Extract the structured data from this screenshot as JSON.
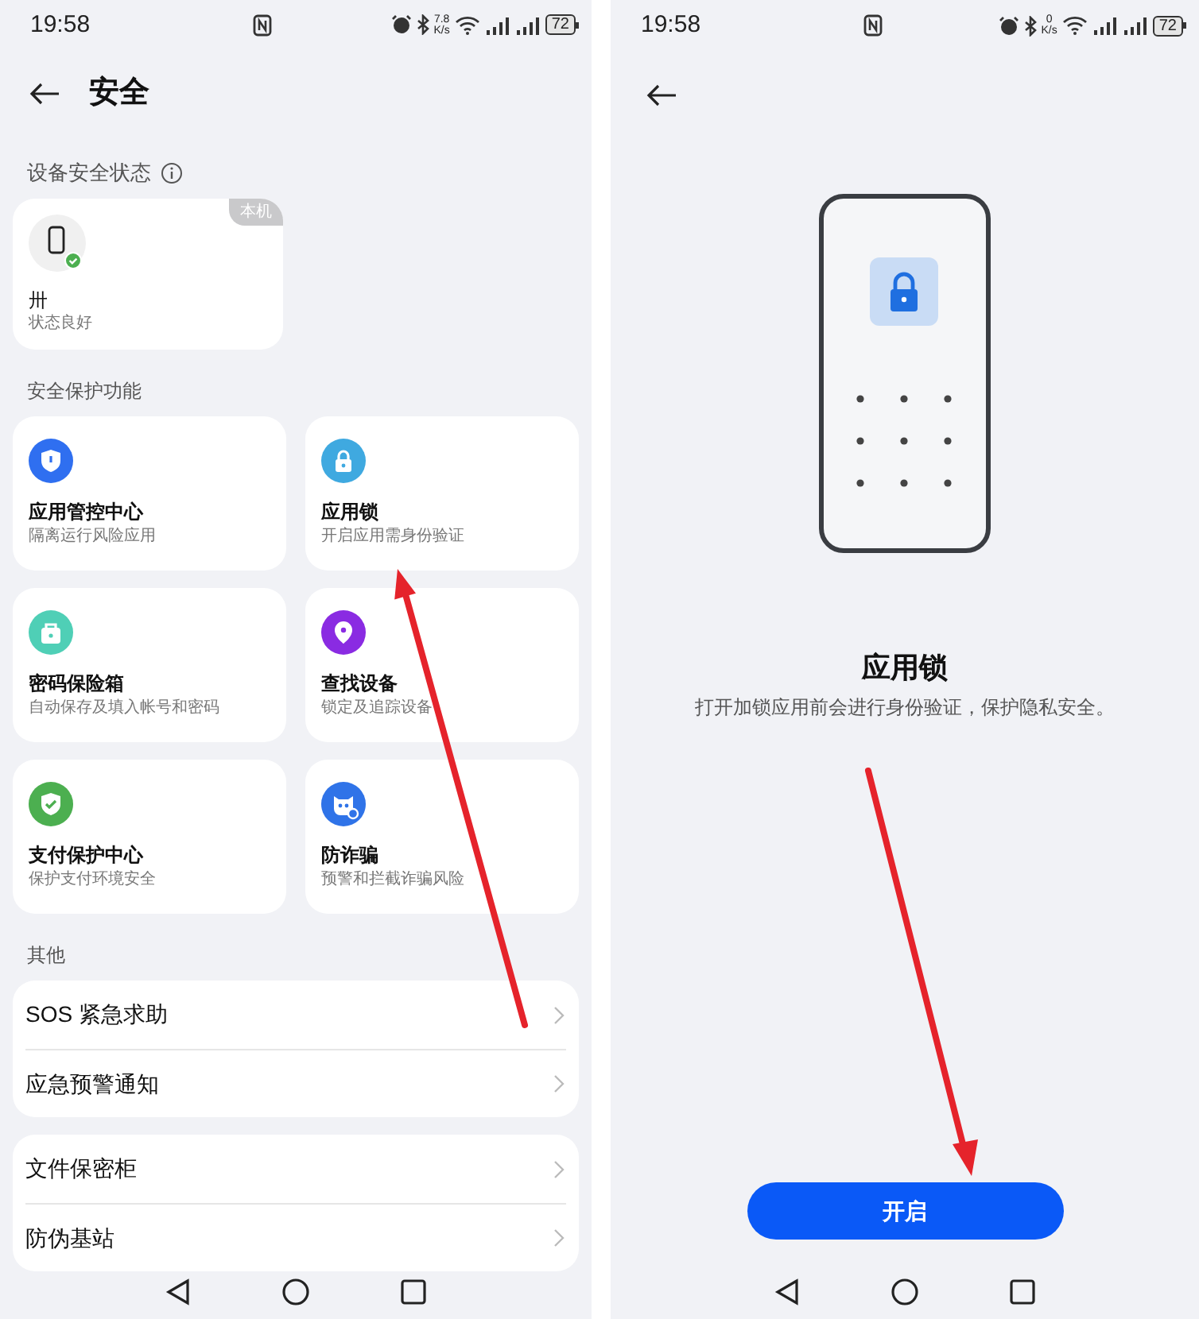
{
  "security_screen": {
    "status_bar": {
      "time": "19:58",
      "speed": "7.8",
      "speed_unit": "K/s",
      "battery": "72"
    },
    "header": {
      "title": "安全"
    },
    "device_section": {
      "label": "设备安全状态",
      "device": {
        "badge": "本机",
        "name": "卅",
        "status": "状态良好"
      }
    },
    "features_section": {
      "label": "安全保护功能",
      "items": [
        {
          "title": "应用管控中心",
          "subtitle": "隔离运行风险应用",
          "kind": "shield",
          "color": "#2f6ff0"
        },
        {
          "title": "应用锁",
          "subtitle": "开启应用需身份验证",
          "kind": "lock",
          "color": "#3fa9e0"
        },
        {
          "title": "密码保险箱",
          "subtitle": "自动保存及填入帐号和密码",
          "kind": "case",
          "color": "#4fcfb6"
        },
        {
          "title": "查找设备",
          "subtitle": "锁定及追踪设备",
          "kind": "pin",
          "color": "#8a2be2"
        },
        {
          "title": "支付保护中心",
          "subtitle": "保护支付环境安全",
          "kind": "check",
          "color": "#4caf50"
        },
        {
          "title": "防诈骗",
          "subtitle": "预警和拦截诈骗风险",
          "kind": "mask",
          "color": "#2f73e8"
        }
      ]
    },
    "other_section": {
      "label": "其他",
      "groups": [
        [
          "SOS 紧急求助",
          "应急预警通知"
        ],
        [
          "文件保密柜",
          "防伪基站"
        ]
      ]
    }
  },
  "app_lock_screen": {
    "status_bar": {
      "time": "19:58",
      "speed": "0",
      "speed_unit": "K/s",
      "battery": "72"
    },
    "title": "应用锁",
    "description": "打开加锁应用前会进行身份验证，保护隐私安全。",
    "button": "开启"
  }
}
